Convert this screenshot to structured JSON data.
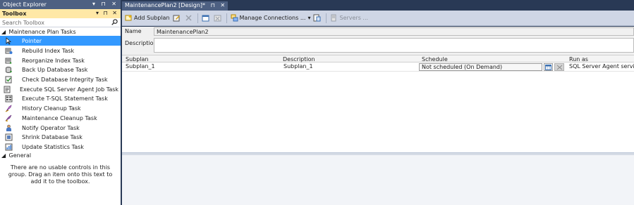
{
  "object_explorer": {
    "title": "Object Explorer",
    "controls": "▾ ⊓ ✕"
  },
  "toolbox": {
    "title": "Toolbox",
    "controls": "▾ ⊓ ✕",
    "search_placeholder": "Search Toolbox",
    "groups": [
      {
        "label": "Maintenance Plan Tasks",
        "items": [
          {
            "label": "Pointer",
            "icon": "pointer-icon",
            "selected": true
          },
          {
            "label": "Rebuild Index Task",
            "icon": "rebuild-index-icon"
          },
          {
            "label": "Reorganize Index Task",
            "icon": "reorganize-index-icon"
          },
          {
            "label": "Back Up Database Task",
            "icon": "backup-database-icon"
          },
          {
            "label": "Check Database Integrity Task",
            "icon": "check-integrity-icon"
          },
          {
            "label": "Execute SQL Server Agent Job Task",
            "icon": "agent-job-icon"
          },
          {
            "label": "Execute T-SQL Statement Task",
            "icon": "tsql-statement-icon"
          },
          {
            "label": "History Cleanup Task",
            "icon": "history-cleanup-icon"
          },
          {
            "label": "Maintenance Cleanup Task",
            "icon": "maintenance-cleanup-icon"
          },
          {
            "label": "Notify Operator Task",
            "icon": "notify-operator-icon"
          },
          {
            "label": "Shrink Database Task",
            "icon": "shrink-database-icon"
          },
          {
            "label": "Update Statistics Task",
            "icon": "update-statistics-icon"
          }
        ]
      },
      {
        "label": "General",
        "message": "There are no usable controls in this group. Drag an item onto this text to add it to the toolbox."
      }
    ]
  },
  "document_tab": {
    "label": "MaintenancePlan2 [Design]*",
    "pin": "⊓",
    "close": "✕"
  },
  "toolbar": {
    "add_subplan": "Add Subplan",
    "manage_connections": "Manage Connections ...",
    "servers": "Servers ..."
  },
  "plan": {
    "name_label": "Name",
    "name_value": "MaintenancePlan2",
    "description_label": "Description",
    "description_value": ""
  },
  "subplan_grid": {
    "columns": [
      "Subplan",
      "Description",
      "Schedule",
      "Run as"
    ],
    "rows": [
      {
        "subplan": "Subplan_1",
        "description": "Subplan_1",
        "schedule": "Not scheduled (On Demand)",
        "run_as": "SQL Server Agent service account"
      }
    ]
  },
  "colors": {
    "frame": "#293955",
    "tab": "#4d6082",
    "toolbox_header": "#ffe8a6",
    "selection": "#3399ff",
    "toolbar": "#cfd6e5"
  }
}
